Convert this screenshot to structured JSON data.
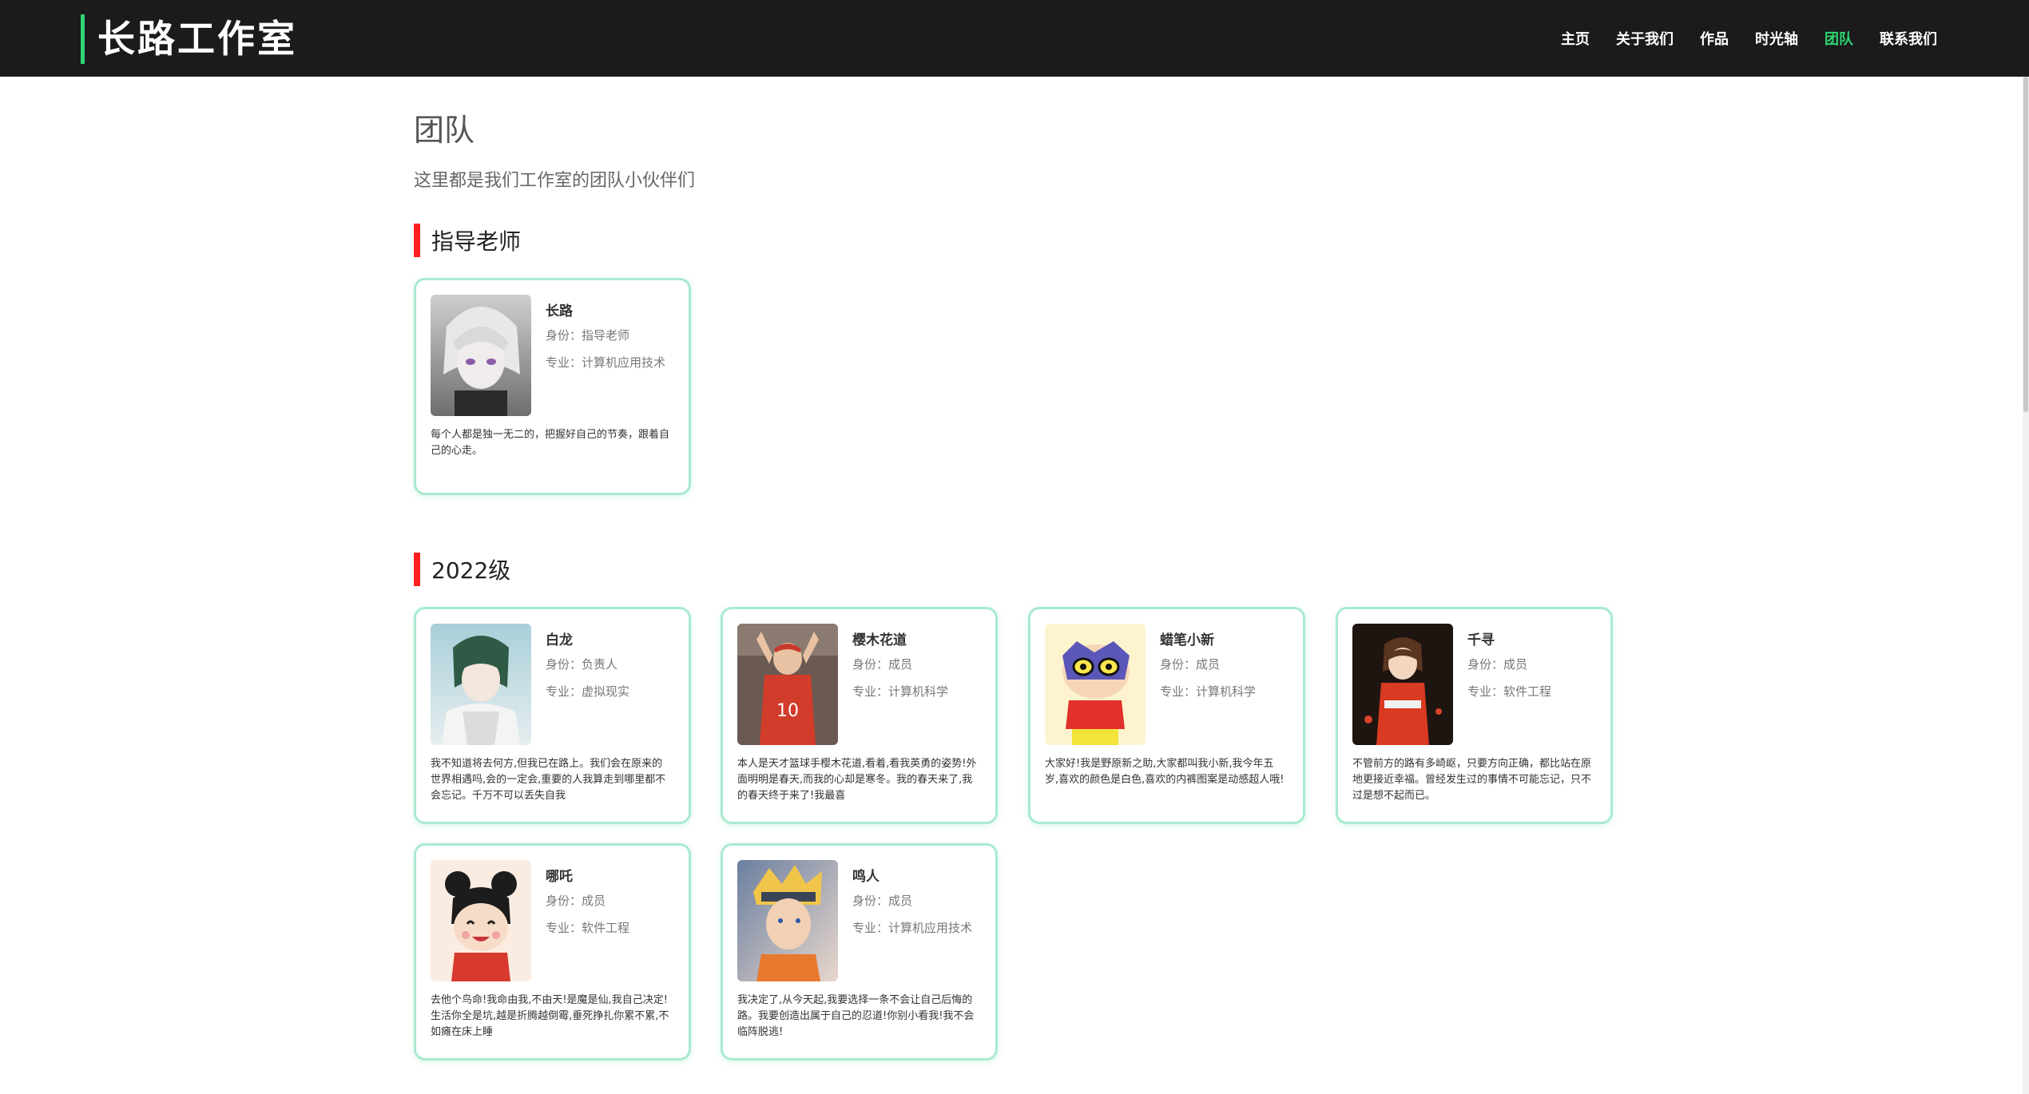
{
  "header": {
    "brand": "长路工作室",
    "accent_color": "#2ed573",
    "nav": [
      {
        "label": "主页",
        "active": false
      },
      {
        "label": "关于我们",
        "active": false
      },
      {
        "label": "作品",
        "active": false
      },
      {
        "label": "时光轴",
        "active": false
      },
      {
        "label": "团队",
        "active": true
      },
      {
        "label": "联系我们",
        "active": false
      }
    ]
  },
  "page": {
    "title": "团队",
    "subtitle": "这里都是我们工作室的团队小伙伴们"
  },
  "sections": [
    {
      "heading": "指导老师",
      "heading_color": "#ff1e1e",
      "members": [
        {
          "name": "长路",
          "role": "身份：指导老师",
          "major": "专业：计算机应用技术",
          "desc": "每个人都是独一无二的，把握好自己的节奏，跟着自己的心走。",
          "avatar": "anime-silver-hair-portrait"
        }
      ]
    },
    {
      "heading": "2022级",
      "heading_color": "#ff1e1e",
      "members": [
        {
          "name": "白龙",
          "role": "身份：负责人",
          "major": "专业：虚拟现实",
          "desc": "我不知道将去何方,但我已在路上。我们会在原来的世界相遇吗,会的一定会,重要的人我算走到哪里都不会忘记。千万不可以丢失自我",
          "avatar": "anime-green-hair-portrait"
        },
        {
          "name": "樱木花道",
          "role": "身份：成员",
          "major": "专业：计算机科学",
          "desc": "本人是天才篮球手樱木花道,看着,看我英勇的姿势!外面明明是春天,而我的心却是寒冬。我的春天来了,我的春天终于来了!我最喜",
          "avatar": "basketball-player-portrait"
        },
        {
          "name": "蜡笔小新",
          "role": "身份：成员",
          "major": "专业：计算机科学",
          "desc": "大家好!我是野原新之助,大家都叫我小新,我今年五岁,喜欢的颜色是白色,喜欢的内裤图案是动感超人哦!",
          "avatar": "cartoon-boy-mask-portrait"
        },
        {
          "name": "千寻",
          "role": "身份：成员",
          "major": "专业：软件工程",
          "desc": "不管前方的路有多崎岖，只要方向正确，都比站在原地更接近幸福。曾经发生过的事情不可能忘记，只不过是想不起而已。",
          "avatar": "anime-girl-red-outfit-portrait"
        },
        {
          "name": "哪吒",
          "role": "身份：成员",
          "major": "专业：软件工程",
          "desc": "去他个鸟命!我命由我,不由天!是魔是仙,我自己决定!生活你全是坑,越是折腾越倒霉,垂死挣扎你累不累,不如瘫在床上睡",
          "avatar": "cartoon-nezha-portrait"
        },
        {
          "name": "鸣人",
          "role": "身份：成员",
          "major": "专业：计算机应用技术",
          "desc": "我决定了,从今天起,我要选择一条不会让自己后悔的路。我要创造出属于自己的忍道!你别小看我!我不会临阵脱逃!",
          "avatar": "anime-ninja-portrait"
        }
      ]
    }
  ]
}
